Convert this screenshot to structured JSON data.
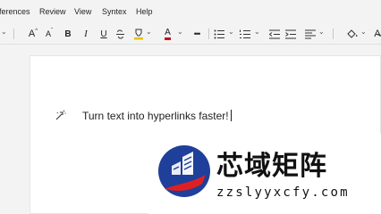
{
  "menu": {
    "items": [
      "ferences",
      "Review",
      "View",
      "Syntex",
      "Help"
    ]
  },
  "toolbar": {
    "grow_font": "A",
    "shrink_font": "A",
    "bold": "B",
    "italic": "I",
    "underline": "U",
    "font_color": "A",
    "more": "•••",
    "highlight_color": "#e5c100",
    "font_color_value": "#c50f1f"
  },
  "document": {
    "text": "Turn text into hyperlinks faster!"
  },
  "watermark": {
    "title": "芯域矩阵",
    "url": "zzslyyxcfy.com"
  }
}
